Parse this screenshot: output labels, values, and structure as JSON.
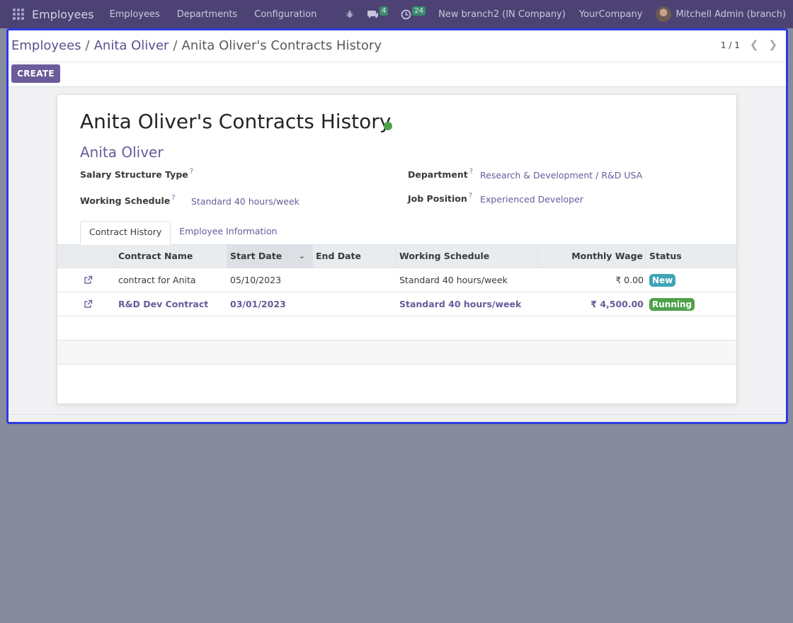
{
  "navbar": {
    "brand": "Employees",
    "menus": [
      "Employees",
      "Departments",
      "Configuration"
    ],
    "messages_count": "4",
    "activities_count": "24",
    "branch": "New branch2 (IN Company)",
    "company": "YourCompany",
    "user": "Mitchell Admin (branch)"
  },
  "breadcrumb": {
    "root": "Employees",
    "employee": "Anita Oliver",
    "current": "Anita Oliver's Contracts History"
  },
  "pager": {
    "value": "1 / 1"
  },
  "create_label": "CREATE",
  "form": {
    "title": "Anita Oliver's Contracts History",
    "employee": "Anita Oliver",
    "salary_structure_label": "Salary Structure Type",
    "working_schedule_label": "Working Schedule",
    "working_schedule_value": "Standard 40 hours/week",
    "department_label": "Department",
    "department_value": "Research & Development / R&D USA",
    "job_position_label": "Job Position",
    "job_position_value": "Experienced Developer",
    "help_mark": "?"
  },
  "tabs": [
    {
      "label": "Contract History",
      "active": true
    },
    {
      "label": "Employee Information",
      "active": false
    }
  ],
  "table": {
    "columns": [
      "Contract Name",
      "Start Date",
      "End Date",
      "Working Schedule",
      "Monthly Wage",
      "Status"
    ],
    "rows": [
      {
        "name": "contract for Anita",
        "start": "05/10/2023",
        "end": "",
        "schedule": "Standard 40 hours/week",
        "wage": "₹ 0.00",
        "status": "New",
        "status_color": "#3ea5b5"
      },
      {
        "name": "R&D Dev Contract",
        "start": "03/01/2023",
        "end": "",
        "schedule": "Standard 40 hours/week",
        "wage": "₹ 4,500.00",
        "status": "Running",
        "status_color": "#4ea24a"
      }
    ]
  },
  "colors": {
    "navbar": "#4c4374",
    "accent": "#6c5b9a",
    "status_dot": "#4ea24a"
  }
}
